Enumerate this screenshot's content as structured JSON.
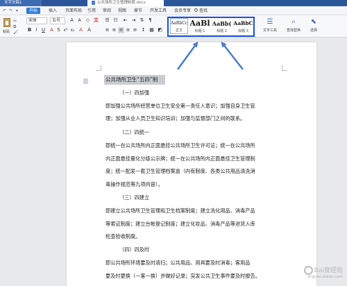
{
  "titlebar": {
    "tab1": "文字文稿1",
    "tab2": "公共场所卫生管理制度.docx"
  },
  "menu": {
    "start": "开始",
    "items": [
      "插入",
      "页面布局",
      "引用",
      "审阅",
      "视图",
      "章节",
      "开发工具",
      "会员专享"
    ],
    "search": "查找"
  },
  "ribbon": {
    "paste": "粘贴",
    "font_name": "宋体",
    "font_size": "五号",
    "styles": [
      {
        "preview": "AaBbCcDd",
        "caption": "正文"
      },
      {
        "preview": "AaBl",
        "caption": "标题 1"
      },
      {
        "preview": "AaBb(",
        "caption": "标题 2"
      },
      {
        "preview": "AaBbC",
        "caption": "标题 3"
      }
    ],
    "text_tools": "文字工具",
    "find_replace": "查找替换",
    "select": "选择"
  },
  "document": {
    "heading": "公共场所卫生“五四”制",
    "lines": [
      "（一）四加强",
      "即加强公共场所经营单位卫生安全第一责任人意识；加强自身卫生管",
      "理；加强从业人员卫生知识培训；加强与监督部门之间的联系。",
      "（二）四统一",
      "即统一在公共场所内正面悬挂公共场所卫生许可证；统一在公共场所",
      "内正面悬挂量化分级公示牌；统一在公共场所内正面悬挂卫生管理制",
      "度；统一配发一套卫生管理档案盒（内有制度、各类公共用品清洗消",
      "毒操作规范等九项内容）。",
      "（三）四建立",
      "即建立公共场所卫生管理和卫生档案制度；建立洗化用品、消毒产品",
      "等索证制度；建立台帐登记制度；建立化妆品、消毒产品等进货入库",
      "检查验收制度。",
      "（四）四及时",
      "即公共场所环境要及时清扫；公共用品、用具要及时消毒；客用品",
      "要及时更换（一客一换）并做好记录；突发公共卫生事件要及时报告。"
    ]
  },
  "watermark": {
    "text": "Bai度经验",
    "url": "jingyan.baidu.com"
  },
  "colors": {
    "titlebar": "#2b579a",
    "highlight_border": "#1a4fe0",
    "arrow": "#4a7ac9",
    "selection": "#c9ccd1"
  }
}
